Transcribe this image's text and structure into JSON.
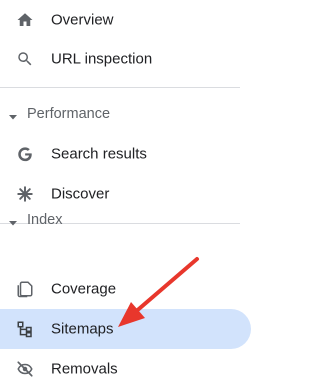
{
  "nav": {
    "top_items": [
      {
        "label": "Overview",
        "icon": "home-icon"
      },
      {
        "label": "URL inspection",
        "icon": "search-icon"
      }
    ],
    "sections": [
      {
        "title": "Performance",
        "items": [
          {
            "label": "Search results",
            "icon": "google-g-icon"
          },
          {
            "label": "Discover",
            "icon": "asterisk-icon"
          }
        ]
      },
      {
        "title": "Index",
        "items": [
          {
            "label": "Coverage",
            "icon": "copy-icon"
          },
          {
            "label": "Sitemaps",
            "icon": "sitemap-icon",
            "active": true
          },
          {
            "label": "Removals",
            "icon": "eye-off-icon"
          }
        ]
      }
    ]
  },
  "colors": {
    "active_bg": "#d2e3fc",
    "text": "#202124",
    "muted_text": "#5f6368",
    "icon": "#5f6368",
    "divider": "#dadce0",
    "annotation_arrow": "#e8372c"
  }
}
